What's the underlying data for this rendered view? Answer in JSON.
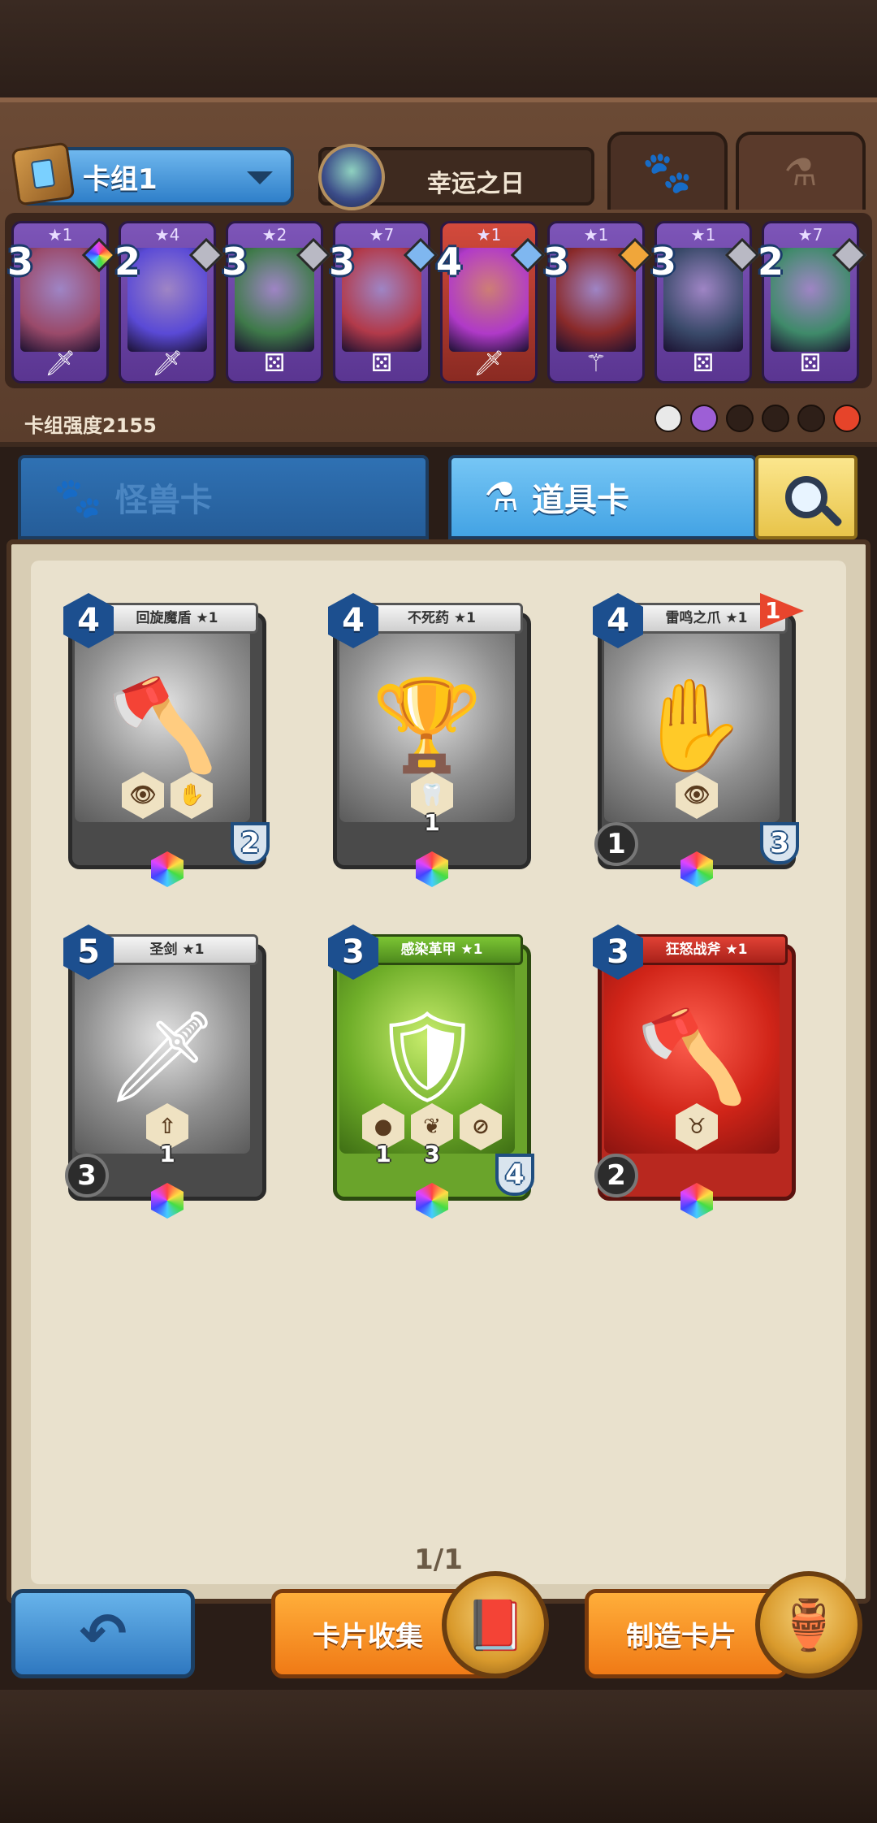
{
  "header": {
    "deck_name": "卡组1",
    "hero_name": "幸运之日",
    "tab_paw_icon": "paw-icon",
    "tab_flask_icon": "flask-icon"
  },
  "deck": {
    "power_label": "卡组强度2155",
    "cards": [
      {
        "cost": "3",
        "stars": "★1",
        "color": "#7d55b8",
        "art": "#9a4a6a",
        "gem": "rainbow",
        "icon": "sword-icon",
        "icon_glyph": "🗡"
      },
      {
        "cost": "2",
        "stars": "★4",
        "color": "#7d55b8",
        "art": "#5a4ad6",
        "gem": "gray",
        "icon": "sword-icon",
        "icon_glyph": "🗡"
      },
      {
        "cost": "3",
        "stars": "★2",
        "color": "#7d55b8",
        "art": "#3f7a4a",
        "gem": "gray",
        "icon": "dice-icon",
        "icon_glyph": "⚄"
      },
      {
        "cost": "3",
        "stars": "★7",
        "color": "#7d55b8",
        "art": "#b23a4a",
        "gem": "blue",
        "icon": "dice-icon",
        "icon_glyph": "⚄"
      },
      {
        "cost": "4",
        "stars": "★1",
        "color": "#d34a3c",
        "art": "#b03ac8",
        "gem": "blue",
        "icon": "sword-icon",
        "icon_glyph": "🗡"
      },
      {
        "cost": "3",
        "stars": "★1",
        "color": "#7d55b8",
        "art": "#8a2a2a",
        "gem": "orange",
        "icon": "staff-icon",
        "icon_glyph": "⚚"
      },
      {
        "cost": "3",
        "stars": "★1",
        "color": "#7d55b8",
        "art": "#3a4a6a",
        "gem": "gray",
        "icon": "dice-icon",
        "icon_glyph": "⚄"
      },
      {
        "cost": "2",
        "stars": "★7",
        "color": "#7d55b8",
        "art": "#3f8a6a",
        "gem": "gray",
        "icon": "dice-icon",
        "icon_glyph": "⚄"
      }
    ],
    "badges": [
      "white",
      "purple",
      "dark",
      "dark",
      "dark",
      "fire"
    ]
  },
  "category_tabs": {
    "monster": "怪兽卡",
    "item": "道具卡"
  },
  "items": [
    {
      "name": "回旋魔盾 ★1",
      "cost": "4",
      "type": "gray",
      "art": "🪓",
      "abilities": [
        "👁",
        "✋"
      ],
      "ability_nums": [
        "",
        ""
      ],
      "right_stat": "2",
      "left_stat": "",
      "flag": ""
    },
    {
      "name": "不死药 ★1",
      "cost": "4",
      "type": "gray",
      "art": "🏆",
      "abilities": [
        "🦷"
      ],
      "ability_nums": [
        "1"
      ],
      "right_stat": "",
      "left_stat": "",
      "flag": ""
    },
    {
      "name": "雷鸣之爪 ★1",
      "cost": "4",
      "type": "gray",
      "art": "✋",
      "abilities": [
        "👁"
      ],
      "ability_nums": [
        ""
      ],
      "right_stat": "3",
      "left_stat": "1",
      "flag": "1"
    },
    {
      "name": "圣剑 ★1",
      "cost": "5",
      "type": "gray",
      "art": "🗡",
      "abilities": [
        "⇧"
      ],
      "ability_nums": [
        "1"
      ],
      "right_stat": "",
      "left_stat": "3",
      "flag": ""
    },
    {
      "name": "感染革甲 ★1",
      "cost": "3",
      "type": "green",
      "art": "🛡",
      "abilities": [
        "●",
        "❦",
        "⊘"
      ],
      "ability_nums": [
        "1",
        "3",
        ""
      ],
      "right_stat": "4",
      "left_stat": "",
      "flag": ""
    },
    {
      "name": "狂怒战斧 ★1",
      "cost": "3",
      "type": "red",
      "art": "🪓",
      "abilities": [
        "♉"
      ],
      "ability_nums": [
        ""
      ],
      "right_stat": "",
      "left_stat": "2",
      "flag": ""
    }
  ],
  "pager": "1/1",
  "bottom": {
    "back_icon": "back-arrow-icon",
    "collect_label": "卡片收集",
    "craft_label": "制造卡片"
  }
}
